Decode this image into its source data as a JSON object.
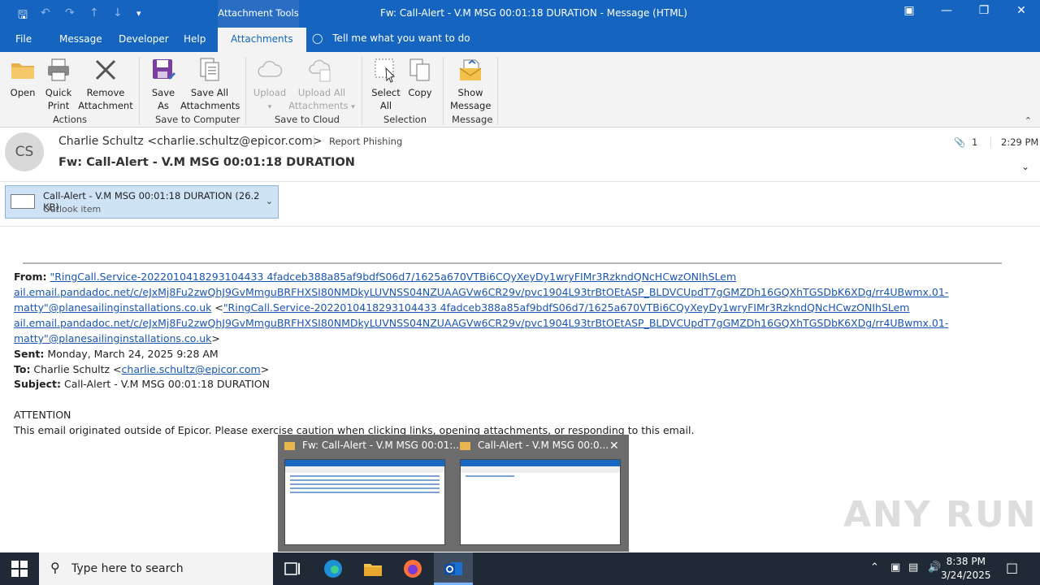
{
  "window": {
    "context_tab": "Attachment Tools",
    "title": "Fw: Call-Alert - V.M MSG 00:01:18 DURATION  -  Message (HTML)"
  },
  "tabs": [
    "File",
    "Message",
    "Developer",
    "Help",
    "Attachments"
  ],
  "tell_me": "Tell me what you want to do",
  "ribbon": {
    "actions": {
      "open": "Open",
      "quick_print_1": "Quick",
      "quick_print_2": "Print",
      "remove_1": "Remove",
      "remove_2": "Attachment",
      "group": "Actions"
    },
    "save_computer": {
      "save_as_1": "Save",
      "save_as_2": "As",
      "save_all_1": "Save All",
      "save_all_2": "Attachments",
      "group": "Save to Computer"
    },
    "save_cloud": {
      "upload": "Upload",
      "upload_all_1": "Upload All",
      "upload_all_2": "Attachments",
      "group": "Save to Cloud"
    },
    "selection": {
      "select_all_1": "Select",
      "select_all_2": "All",
      "copy": "Copy",
      "group": "Selection"
    },
    "message": {
      "show_1": "Show",
      "show_2": "Message",
      "group": "Message"
    }
  },
  "header": {
    "avatar_initials": "CS",
    "sender": "Charlie Schultz <charlie.schultz@epicor.com>",
    "report_phishing": "Report Phishing",
    "subject": "Fw: Call-Alert - V.M MSG 00:01:18 DURATION",
    "attachment_count": "1",
    "time": "2:29 PM"
  },
  "attachment": {
    "name": "Call-Alert - V.M MSG 00:01:18 DURATION (26.2 KB)",
    "type": "Outlook item"
  },
  "body": {
    "from_label": "From:",
    "from_link_1": "\"RingCall.Service-2022010418293104433 4fadceb388a85af9bdfS06d7/1625a670VTBi6CQyXeyDy1wryFIMr3RzkndQNcHCwzONIhSLem",
    "from_link_2": "ail.email.pandadoc.net/c/eJxMj8Fu2zwQhJ9GvMmguBRFHXSI80NMDkyLUVNSS04NZUAAGVw6CR29v/pvc1904L93trBtOEtASP_BLDVCUpdT7gGMZDh16GQXhTGSDbK6XDg/rr4UBwmx.01-",
    "from_link_3a": "matty\"@planesailinginstallations.co.uk",
    "from_sep": " <",
    "from_link_3b": "\"RingCall.Service-2022010418293104433 4fadceb388a85af9bdfS06d7/1625a670VTBi6CQyXeyDy1wryFIMr3RzkndQNcHCwzONIhSLem",
    "from_link_4": "ail.email.pandadoc.net/c/eJxMj8Fu2zwQhJ9GvMmguBRFHXSI80NMDkyLUVNSS04NZUAAGVw6CR29v/pvc1904L93trBtOEtASP_BLDVCUpdT7gGMZDh16GQXhTGSDbK6XDg/rr4UBwmx.01-",
    "from_link_5": "matty\"@planesailinginstallations.co.uk",
    "from_end": ">",
    "sent_label": "Sent:",
    "sent": " Monday, March 24, 2025 9:28 AM",
    "to_label": "To:",
    "to_name": " Charlie Schultz <",
    "to_link": "charlie.schultz@epicor.com",
    "to_end": ">",
    "subject_label": "Subject:",
    "subject": " Call-Alert - V.M MSG 00:01:18  DURATION",
    "attention": "ATTENTION",
    "warning": "This email originated outside of Epicor. Please exercise caution when clicking links, opening attachments, or responding to this email."
  },
  "thumbnails": [
    {
      "title": "Fw: Call-Alert - V.M MSG 00:01:..."
    },
    {
      "title": "Call-Alert - V.M MSG 00:0..."
    }
  ],
  "watermark": "ANY RUN",
  "taskbar": {
    "search_placeholder": "Type here to search",
    "time": "8:38 PM",
    "date": "3/24/2025"
  },
  "colors": {
    "accent": "#1565c0",
    "link": "#1a56b4",
    "attachment_bg": "#cfe3f7"
  }
}
